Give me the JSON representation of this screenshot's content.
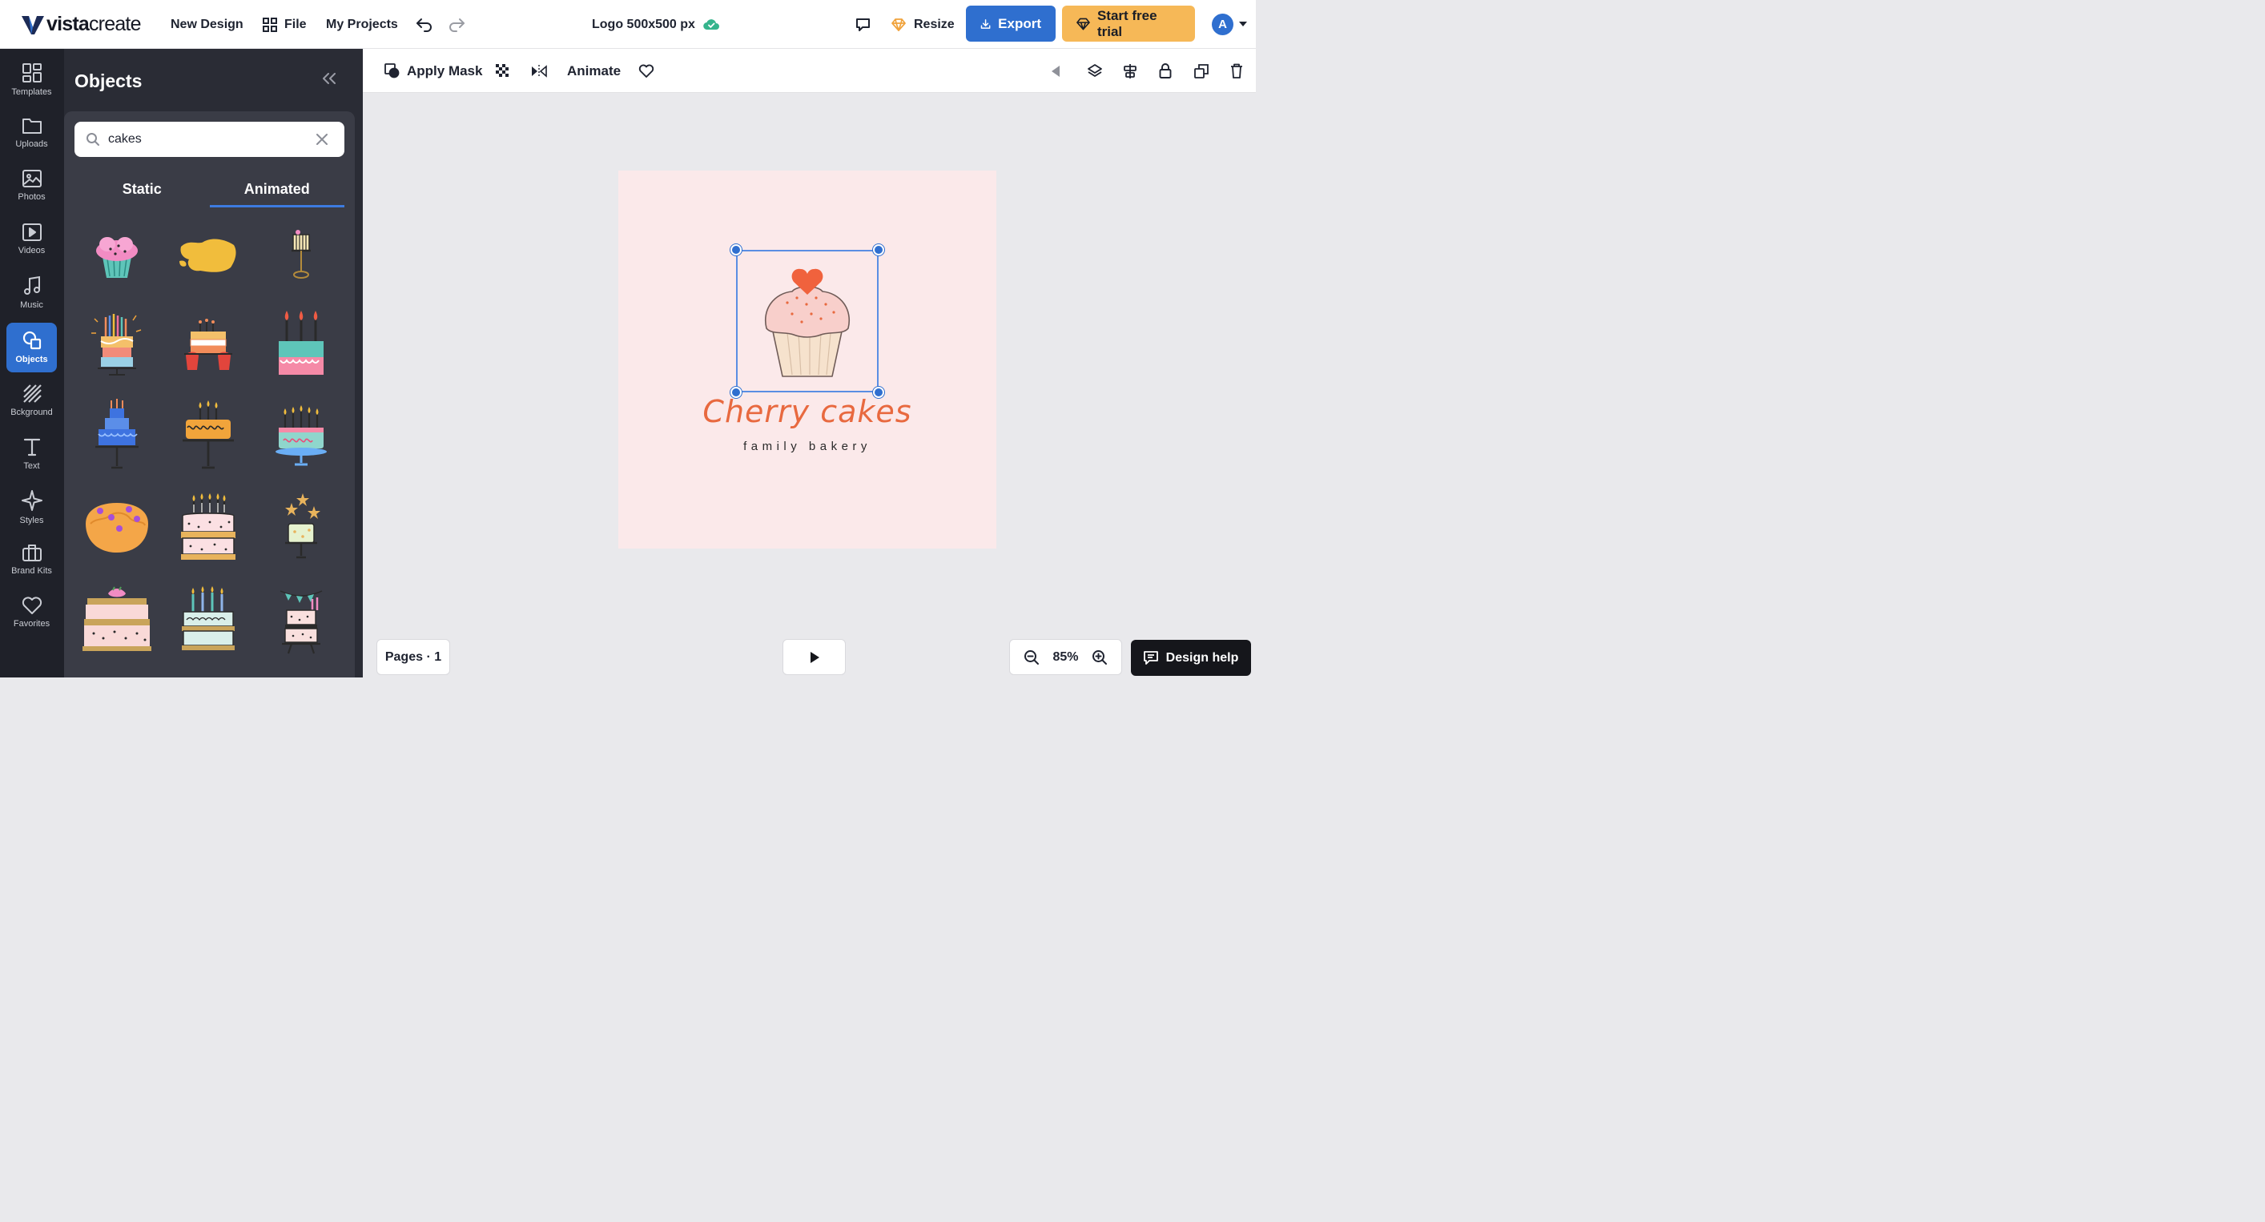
{
  "app": {
    "logo": {
      "prefix": "vista",
      "suffix": "create"
    },
    "menu": {
      "new_design": "New Design",
      "file": "File",
      "my_projects": "My Projects"
    },
    "document_title": "Logo 500x500 px",
    "resize": "Resize",
    "export": "Export",
    "trial": "Start free trial",
    "avatar_initial": "A"
  },
  "rail": [
    {
      "label": "Templates",
      "icon": "templates-icon"
    },
    {
      "label": "Uploads",
      "icon": "folder-icon"
    },
    {
      "label": "Photos",
      "icon": "image-icon"
    },
    {
      "label": "Videos",
      "icon": "video-icon"
    },
    {
      "label": "Music",
      "icon": "music-icon"
    },
    {
      "label": "Objects",
      "icon": "shapes-icon",
      "active": true
    },
    {
      "label": "Bckground",
      "icon": "background-icon"
    },
    {
      "label": "Text",
      "icon": "text-icon"
    },
    {
      "label": "Styles",
      "icon": "sparkle-icon"
    },
    {
      "label": "Brand Kits",
      "icon": "briefcase-icon"
    },
    {
      "label": "Favorites",
      "icon": "heart-icon"
    }
  ],
  "panel": {
    "title": "Objects",
    "search": {
      "value": "cakes",
      "placeholder": "Search"
    },
    "tabs": [
      {
        "label": "Static"
      },
      {
        "label": "Animated",
        "active": true
      }
    ]
  },
  "toolbar": {
    "apply_mask": "Apply Mask",
    "animate": "Animate"
  },
  "canvas": {
    "brand_name": "Cherry cakes",
    "tagline": "family bakery",
    "background_color": "#fbe9ea",
    "accent_color": "#e8693f"
  },
  "footer": {
    "pages": "Pages · 1",
    "zoom": "85%",
    "help": "Design help"
  },
  "colors": {
    "primary": "#2f6fcf",
    "trial": "#f6b857",
    "panel": "#2a2c35",
    "rail": "#1f2129"
  }
}
